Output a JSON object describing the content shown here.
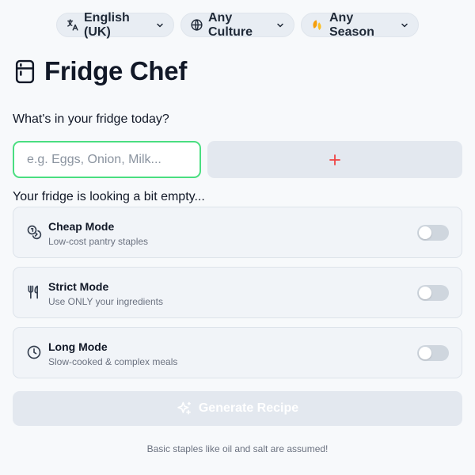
{
  "header": {
    "language": {
      "label": "English (UK)",
      "icon": "translate-icon"
    },
    "culture": {
      "label": "Any Culture",
      "icon": "globe-icon"
    },
    "season": {
      "label": "Any Season",
      "icon": "leaves-icon"
    }
  },
  "app": {
    "title": "Fridge Chef",
    "icon": "fridge-icon"
  },
  "ingredients": {
    "prompt": "What's in your fridge today?",
    "input_value": "",
    "input_placeholder": "e.g. Eggs, Onion, Milk...",
    "add_icon": "plus-icon",
    "empty_message": "Your fridge is looking a bit empty..."
  },
  "modes": [
    {
      "name": "Cheap Mode",
      "description": "Low-cost pantry staples",
      "icon": "coins-icon",
      "enabled": false
    },
    {
      "name": "Strict Mode",
      "description": "Use ONLY your ingredients",
      "icon": "utensils-icon",
      "enabled": false
    },
    {
      "name": "Long Mode",
      "description": "Slow-cooked & complex meals",
      "icon": "clock-icon",
      "enabled": false
    }
  ],
  "generate": {
    "label": "Generate Recipe",
    "icon": "sparkles-icon",
    "disabled": true
  },
  "footer": {
    "note": "Basic staples like oil and salt are assumed!"
  },
  "colors": {
    "accent_green": "#4ade80",
    "plus_red": "#ef4444",
    "card_bg": "#f1f4f8",
    "button_disabled": "#e3e8ef"
  }
}
